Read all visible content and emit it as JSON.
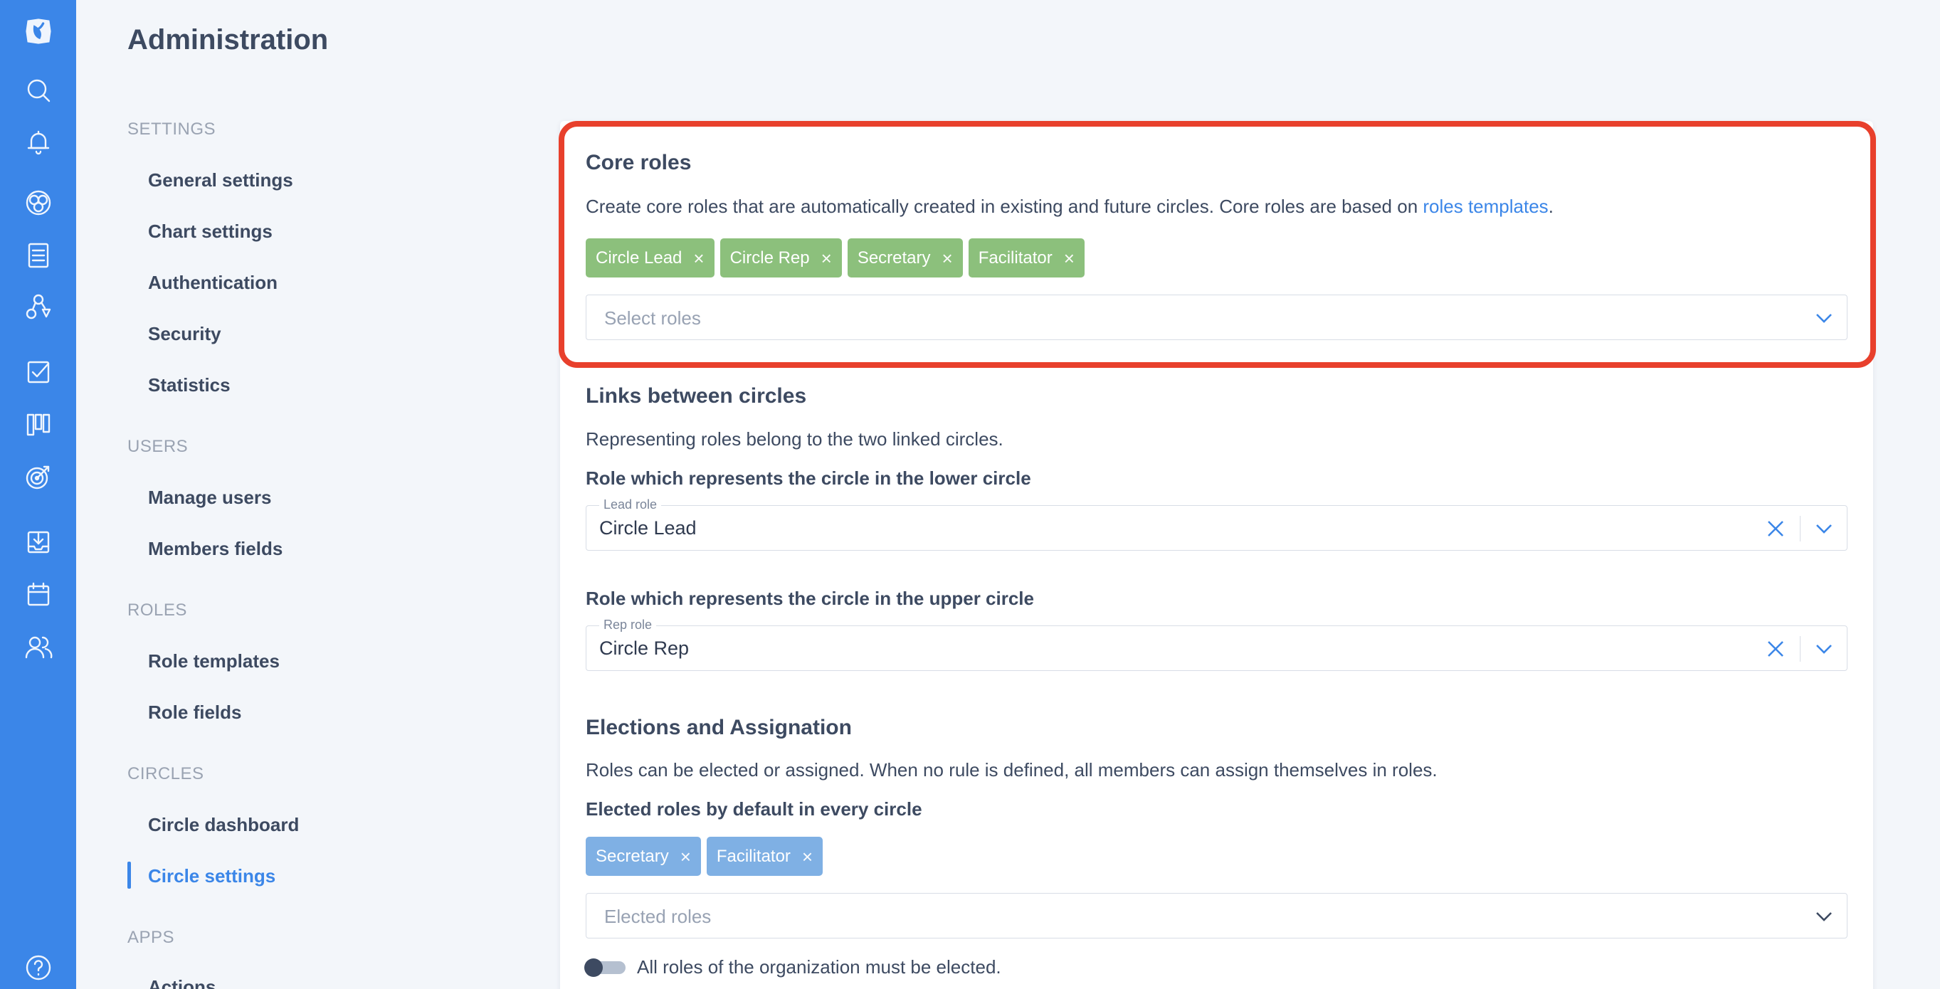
{
  "app": {
    "page_title": "Administration",
    "accent_color": "#3b86e8",
    "highlight_color": "#e8402c"
  },
  "rail": {
    "icons": [
      "logo-icon",
      "search-icon",
      "bell-icon",
      "circles-icon",
      "document-icon",
      "roles-icon",
      "checkbox-icon",
      "board-icon",
      "target-icon",
      "inbox-icon",
      "calendar-icon",
      "users-icon",
      "help-icon"
    ]
  },
  "nav": {
    "settings_header": "SETTINGS",
    "general_settings": "General settings",
    "chart_settings": "Chart settings",
    "authentication": "Authentication",
    "security": "Security",
    "statistics": "Statistics",
    "users_header": "USERS",
    "manage_users": "Manage users",
    "members_fields": "Members fields",
    "roles_header": "ROLES",
    "role_templates": "Role templates",
    "role_fields": "Role fields",
    "circles_header": "CIRCLES",
    "circle_dashboard": "Circle dashboard",
    "circle_settings": "Circle settings",
    "apps_header": "APPS",
    "actions": "Actions"
  },
  "core_roles": {
    "title": "Core roles",
    "description": "Create core roles that are automatically created in existing and future circles. Core roles are based on ",
    "link_text": "roles templates",
    "description_end": ".",
    "chips": [
      "Circle Lead",
      "Circle Rep",
      "Secretary",
      "Facilitator"
    ],
    "select_placeholder": "Select roles"
  },
  "links": {
    "title": "Links between circles",
    "description": "Representing roles belong to the two linked circles.",
    "lower_title": "Role which represents the circle in the lower circle",
    "lower_label": "Lead role",
    "lower_value": "Circle Lead",
    "upper_title": "Role which represents the circle in the upper circle",
    "upper_label": "Rep role",
    "upper_value": "Circle Rep"
  },
  "elections": {
    "title": "Elections and Assignation",
    "description": "Roles can be elected or assigned. When no rule is defined, all members can assign themselves in roles.",
    "elected_title": "Elected roles by default in every circle",
    "chips": [
      "Secretary",
      "Facilitator"
    ],
    "select_placeholder": "Elected roles",
    "toggle_label": "All roles of the organization must be elected.",
    "toggle_on": false
  }
}
